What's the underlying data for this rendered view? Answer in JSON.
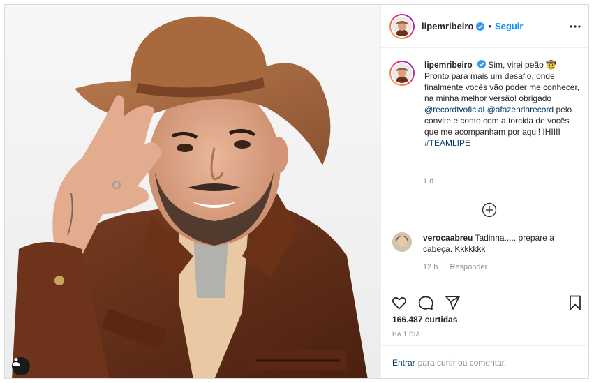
{
  "post": {
    "username": "lipemribeiro",
    "follow_label": "Seguir",
    "separator": "•",
    "caption": {
      "username": "lipemribeiro",
      "text_1": "Sim, virei peão 🤠 Pronto para mais um desafio, onde finalmente vocês vão poder me conhecer, na minha melhor versão! obrigado ",
      "mention_1": "@recordtvoficial",
      "text_2": " ",
      "mention_2": "@afazendarecord",
      "text_3": " pelo convite e conto com a torcida de vocês que me acompanham por aqui! IHIIII ",
      "hashtag": "#TEAMLIPE"
    },
    "age": "1 d",
    "comment": {
      "username": "verocaabreu",
      "text": "Tadinha..... prepare a cabeça. Kkkkkkk",
      "time": "12 h",
      "reply_label": "Responder"
    },
    "likes": "166.487 curtidas",
    "date": "HÁ 1 DIA",
    "login": {
      "enter_label": "Entrar",
      "rest_label": "para curtir ou comentar."
    }
  },
  "icons": {
    "verified": "verified-badge-icon",
    "more": "more-options-icon",
    "load_more": "plus-circle-icon",
    "like": "heart-icon",
    "comment": "comment-bubble-icon",
    "share": "paper-plane-icon",
    "save": "bookmark-icon",
    "tagged": "user-tag-icon"
  },
  "colors": {
    "accent": "#0095f6",
    "link": "#00376b",
    "muted": "#8e8e8e",
    "text": "#262626"
  }
}
